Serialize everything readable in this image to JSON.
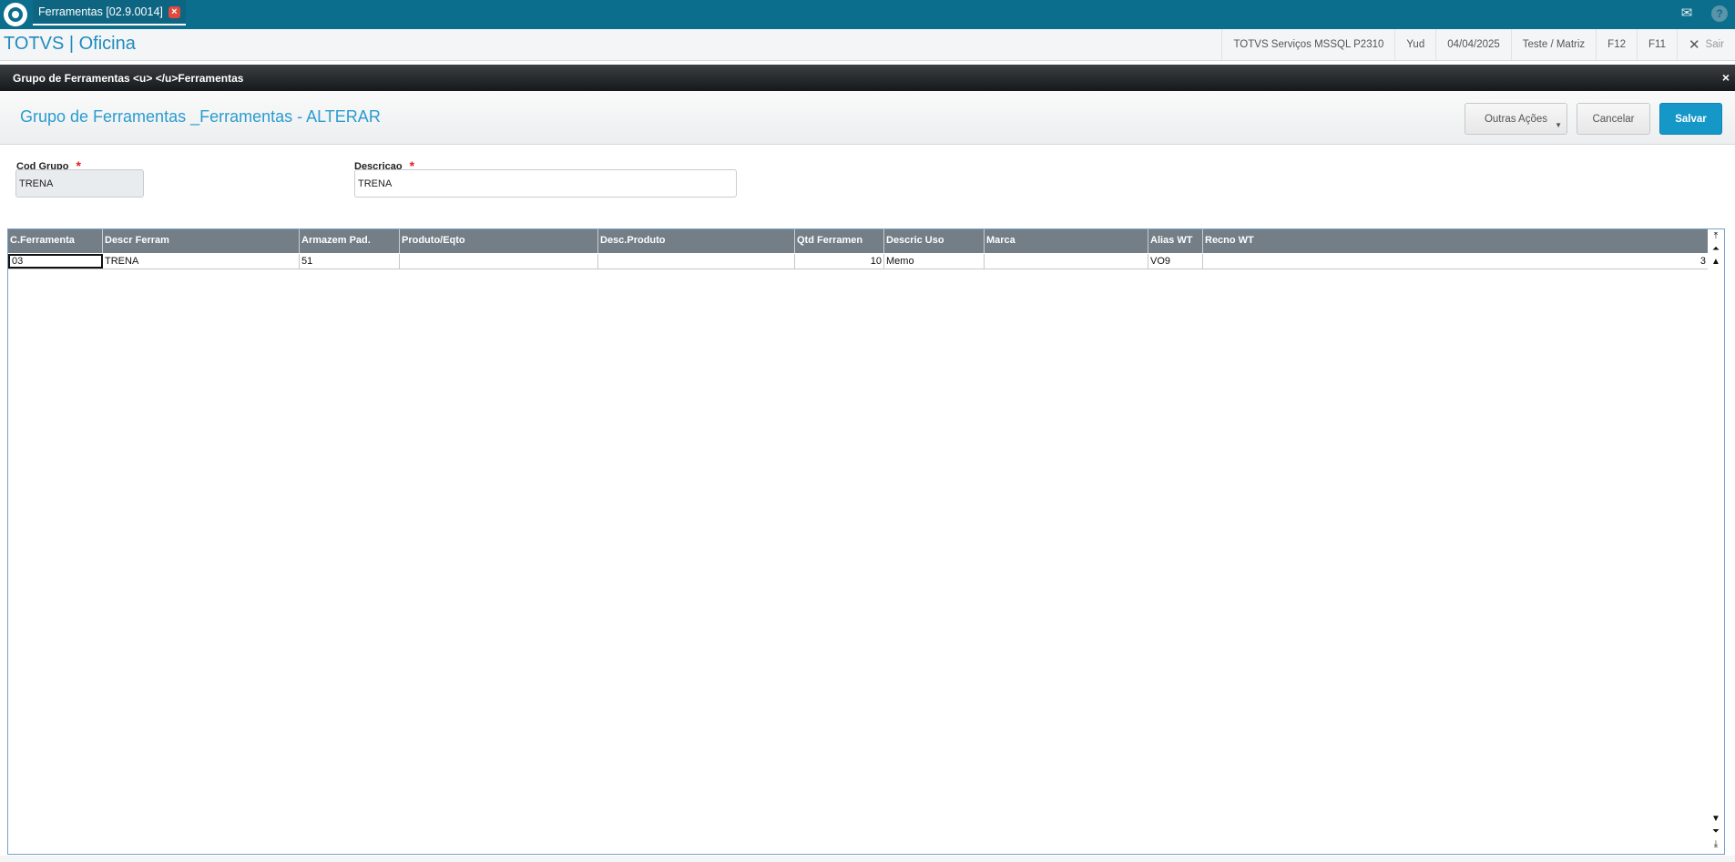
{
  "tabbar": {
    "tab_title": "Ferramentas [02.9.0014]"
  },
  "header": {
    "brand": "TOTVS | Oficina",
    "environment": "TOTVS Serviços MSSQL P2310",
    "user": "Yud",
    "date": "04/04/2025",
    "branch": "Teste / Matriz",
    "key_f12": "F12",
    "key_f11": "F11",
    "exit_label": "Sair"
  },
  "dialog": {
    "title": "Grupo de Ferramentas <u> </u>Ferramentas",
    "form_title": "Grupo de Ferramentas _Ferramentas - ALTERAR",
    "buttons": {
      "outras": "Outras Ações",
      "cancelar": "Cancelar",
      "salvar": "Salvar"
    }
  },
  "fields": {
    "cod_grupo": {
      "label": "Cod Grupo",
      "required": "*",
      "value": "TRENA"
    },
    "descricao": {
      "label": "Descricao",
      "required": "*",
      "value": "TRENA"
    }
  },
  "grid": {
    "columns": [
      "C.Ferramenta",
      "Descr Ferram",
      "Armazem Pad.",
      "Produto/Eqto",
      "Desc.Produto",
      "Qtd Ferramen",
      "Descric Uso",
      "Marca",
      "Alias WT",
      "Recno WT"
    ],
    "rows": [
      [
        "03",
        "TRENA",
        "51",
        "",
        "",
        "10",
        "Memo",
        "",
        "VO9",
        "3"
      ]
    ]
  },
  "colors": {
    "topbar": "#0b6e8c",
    "brand": "#1f8bbf",
    "accent_button": "#1597c8",
    "grid_header": "#737e86"
  },
  "icons": {
    "logo": "totvs-logo-icon",
    "tab_close": "close-icon",
    "mail": "mail-icon",
    "help": "help-icon",
    "exit": "x-icon",
    "scroll": [
      "scroll-first-icon",
      "scroll-page-up-icon",
      "scroll-up-icon",
      "scroll-down-icon",
      "scroll-page-down-icon",
      "scroll-last-icon"
    ]
  }
}
